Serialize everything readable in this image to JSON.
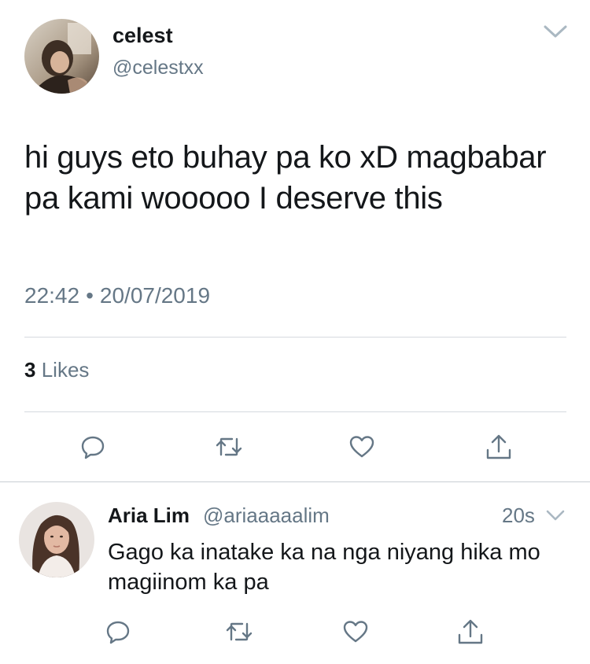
{
  "tweet": {
    "author": {
      "name": "celest",
      "handle": "@celestxx",
      "avatar_icon": "profile-photo"
    },
    "text": "hi guys eto buhay pa ko xD magbabar pa kami wooooo I deserve this",
    "time": "22:42",
    "separator": "•",
    "date": "20/07/2019",
    "likes": {
      "count": "3",
      "label": "Likes"
    },
    "actions": [
      "reply-icon",
      "retweet-icon",
      "like-icon",
      "share-icon"
    ]
  },
  "reply": {
    "author": {
      "name": "Aria Lim",
      "handle": "@ariaaaaalim",
      "avatar_icon": "profile-photo"
    },
    "time": "20s",
    "text": "Gago ka inatake ka na nga niyang hika mo magiinom ka pa",
    "actions": [
      "reply-icon",
      "retweet-icon",
      "like-icon",
      "share-icon"
    ]
  },
  "colors": {
    "text_primary": "#14171a",
    "text_secondary": "#657786",
    "divider": "#d5dadf",
    "icon": "#657786"
  }
}
